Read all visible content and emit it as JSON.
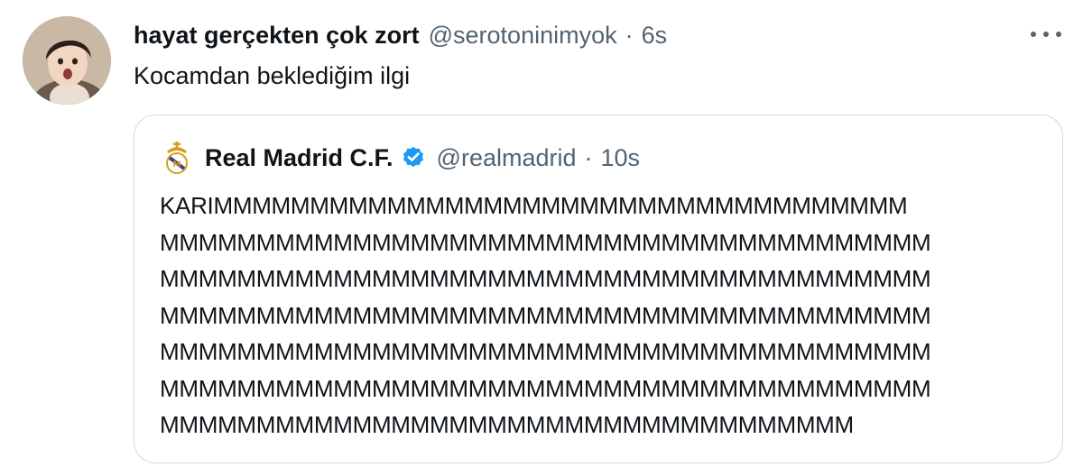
{
  "tweet": {
    "display_name": "hayat gerçekten çok zort",
    "handle": "@serotoninimyok",
    "separator": "·",
    "time": "6s",
    "text": "Kocamdan beklediğim ilgi",
    "more_icon": "more-horizontal-icon"
  },
  "quoted": {
    "display_name": "Real Madrid C.F.",
    "verified_icon": "verified-badge-icon",
    "handle": "@realmadrid",
    "separator": "·",
    "time": "10s",
    "lines": [
      "KARIMMMMMMMMMMMMMMMMMMMMMMMMMMMMMMMMMMMM",
      "MMMMMMMMMMMMMMMMMMMMMMMMMMMMMMMMMMMMMMMM",
      "MMMMMMMMMMMMMMMMMMMMMMMMMMMMMMMMMMMMMMMM",
      "MMMMMMMMMMMMMMMMMMMMMMMMMMMMMMMMMMMMMMMM",
      "MMMMMMMMMMMMMMMMMMMMMMMMMMMMMMMMMMMMMMMM",
      "MMMMMMMMMMMMMMMMMMMMMMMMMMMMMMMMMMMMMMMM",
      "MMMMMMMMMMMMMMMMMMMMMMMMMMMMMMMMMMMM"
    ]
  },
  "colors": {
    "text_primary": "#0f1419",
    "text_secondary": "#536471",
    "border": "#cfd9de",
    "verified": "#1d9bf0"
  }
}
